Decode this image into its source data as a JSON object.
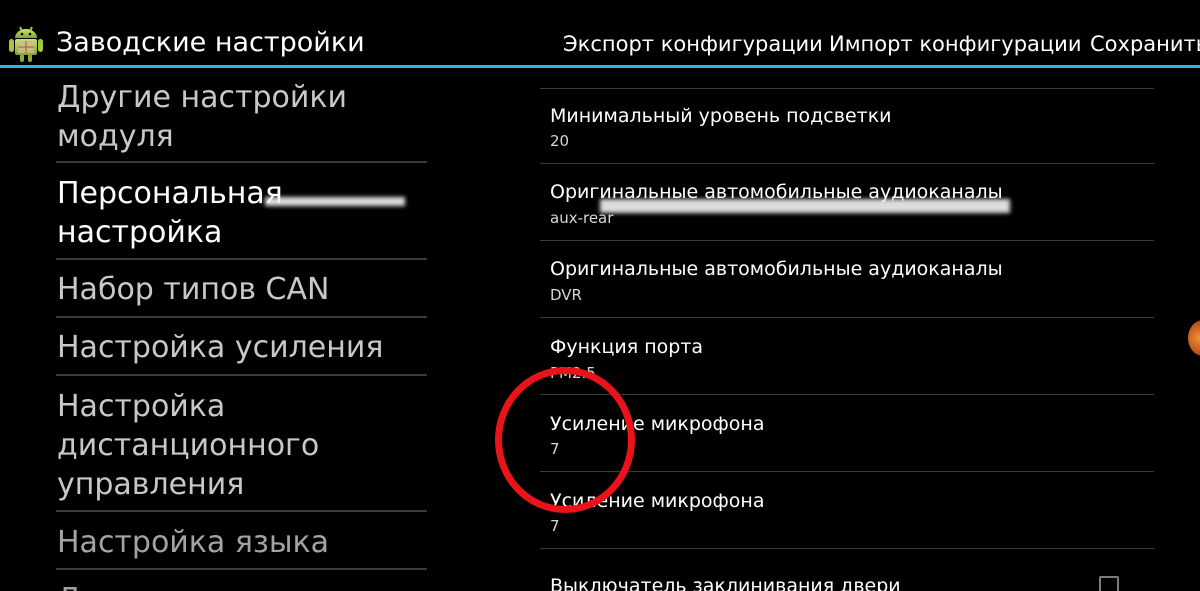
{
  "action_bar": {
    "icon": "android-robot-icon",
    "title": "Заводские настройки",
    "actions": {
      "export": "Экспорт конфигурации",
      "import": "Импорт конфигурации",
      "save": "Сохранить"
    },
    "accent_color": "#33b5e5"
  },
  "categories": [
    {
      "label": "Другие настройки модуля"
    },
    {
      "label": "Персональная настройка"
    },
    {
      "label": "Набор типов CAN"
    },
    {
      "label": "Настройка усиления"
    },
    {
      "label": "Настройка дистанционного управления"
    },
    {
      "label": "Настройка языка"
    },
    {
      "label": "Л"
    }
  ],
  "preferences": [
    {
      "title": "Минимальный уровень подсветки",
      "summary": "20"
    },
    {
      "title": "Оригинальные автомобильные аудиоканалы",
      "summary": "aux-rear"
    },
    {
      "title": "Оригинальные автомобильные аудиоканалы",
      "summary": "DVR"
    },
    {
      "title": "Функция порта",
      "summary": "PM2.5"
    },
    {
      "title": "Усиление микрофона",
      "summary": "7"
    },
    {
      "title": "Усиление микрофона",
      "summary": "7"
    },
    {
      "title": "Выключатель заклинивания двери",
      "checked": false
    }
  ],
  "annotation": {
    "color": "#e8141a",
    "target": "Усиление микрофона"
  }
}
